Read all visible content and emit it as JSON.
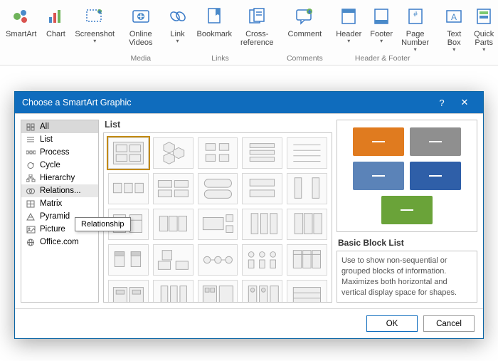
{
  "ribbon": {
    "groups": [
      {
        "label": "",
        "items": [
          {
            "label": "SmartArt",
            "icon": "smartart"
          },
          {
            "label": "Chart",
            "icon": "chart"
          },
          {
            "label": "Screenshot",
            "icon": "screenshot",
            "caret": true
          }
        ]
      },
      {
        "label": "Media",
        "items": [
          {
            "label": "Online\nVideos",
            "icon": "video"
          }
        ]
      },
      {
        "label": "Links",
        "items": [
          {
            "label": "Link",
            "icon": "link",
            "caret": true
          },
          {
            "label": "Bookmark",
            "icon": "bookmark"
          },
          {
            "label": "Cross-\nreference",
            "icon": "crossref"
          }
        ]
      },
      {
        "label": "Comments",
        "items": [
          {
            "label": "Comment",
            "icon": "comment"
          }
        ]
      },
      {
        "label": "Header & Footer",
        "items": [
          {
            "label": "Header",
            "icon": "header",
            "caret": true
          },
          {
            "label": "Footer",
            "icon": "footer",
            "caret": true
          },
          {
            "label": "Page\nNumber",
            "icon": "pagenum",
            "caret": true
          }
        ]
      },
      {
        "label": "",
        "items": [
          {
            "label": "Text\nBox",
            "icon": "textbox",
            "caret": true
          },
          {
            "label": "Quick\nParts",
            "icon": "quickparts",
            "caret": true
          }
        ]
      }
    ]
  },
  "dialog": {
    "title": "Choose a SmartArt Graphic",
    "help": "?",
    "close": "✕",
    "categories": [
      {
        "label": "All",
        "icon": "all",
        "state": "sel"
      },
      {
        "label": "List",
        "icon": "list"
      },
      {
        "label": "Process",
        "icon": "process"
      },
      {
        "label": "Cycle",
        "icon": "cycle"
      },
      {
        "label": "Hierarchy",
        "icon": "hierarchy"
      },
      {
        "label": "Relations...",
        "icon": "relationship",
        "state": "hover"
      },
      {
        "label": "Matrix",
        "icon": "matrix"
      },
      {
        "label": "Pyramid",
        "icon": "pyramid"
      },
      {
        "label": "Picture",
        "icon": "picture"
      },
      {
        "label": "Office.com",
        "icon": "office"
      }
    ],
    "tooltip": "Relationship",
    "gallery_title": "List",
    "thumb_count": 25,
    "preview": {
      "blocks": [
        "#e07b1f",
        "#8f8f8f",
        "#5b83b8",
        "#2f5fa8",
        "#6aa339"
      ],
      "title": "Basic Block List",
      "desc": "Use to show non-sequential or grouped blocks of information. Maximizes both horizontal and vertical display space for shapes."
    },
    "ok": "OK",
    "cancel": "Cancel"
  }
}
